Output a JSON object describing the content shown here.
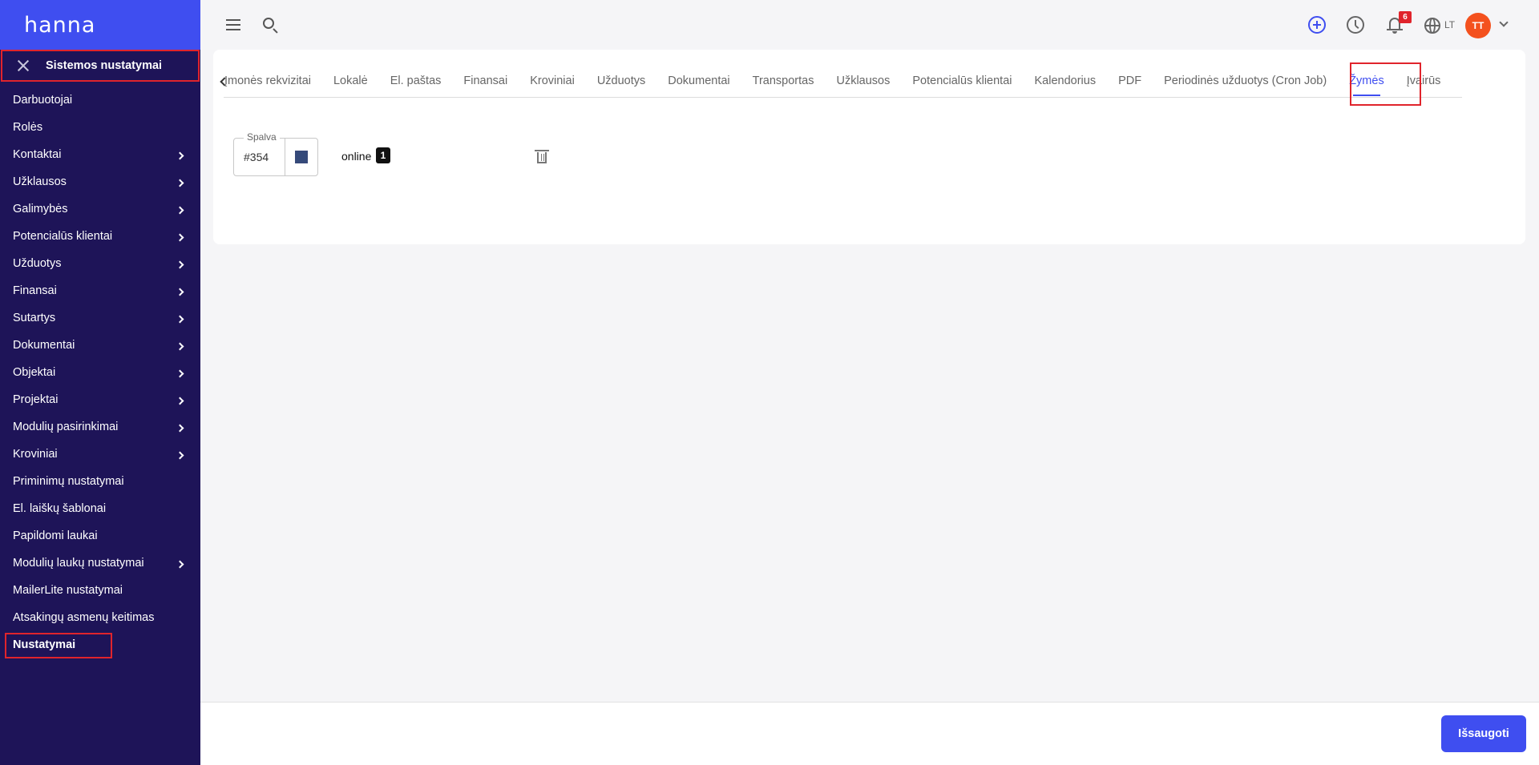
{
  "app": {
    "logo": "hanna"
  },
  "sidebar": {
    "header_title": "Sistemos nustatymai",
    "items": [
      {
        "label": "Darbuotojai",
        "chevron": false
      },
      {
        "label": "Rolės",
        "chevron": false
      },
      {
        "label": "Kontaktai",
        "chevron": true
      },
      {
        "label": "Užklausos",
        "chevron": true
      },
      {
        "label": "Galimybės",
        "chevron": true
      },
      {
        "label": "Potencialūs klientai",
        "chevron": true
      },
      {
        "label": "Užduotys",
        "chevron": true
      },
      {
        "label": "Finansai",
        "chevron": true
      },
      {
        "label": "Sutartys",
        "chevron": true
      },
      {
        "label": "Dokumentai",
        "chevron": true
      },
      {
        "label": "Objektai",
        "chevron": true
      },
      {
        "label": "Projektai",
        "chevron": true
      },
      {
        "label": "Modulių pasirinkimai",
        "chevron": true
      },
      {
        "label": "Kroviniai",
        "chevron": true
      },
      {
        "label": "Priminimų nustatymai",
        "chevron": false
      },
      {
        "label": "El. laiškų šablonai",
        "chevron": false
      },
      {
        "label": "Papildomi laukai",
        "chevron": false
      },
      {
        "label": "Modulių laukų nustatymai",
        "chevron": true
      },
      {
        "label": "MailerLite nustatymai",
        "chevron": false
      },
      {
        "label": "Atsakingų asmenų keitimas",
        "chevron": false
      },
      {
        "label": "Nustatymai",
        "chevron": false,
        "active": true
      }
    ]
  },
  "topbar": {
    "notification_count": "6",
    "language": "LT",
    "avatar_initials": "TT"
  },
  "tabs": {
    "items": [
      "Įmonės rekvizitai",
      "Lokalė",
      "El. paštas",
      "Finansai",
      "Kroviniai",
      "Užduotys",
      "Dokumentai",
      "Transportas",
      "Užklausos",
      "Potencialūs klientai",
      "Kalendorius",
      "PDF",
      "Periodinės užduotys (Cron Job)",
      "Žymės",
      "Įvairūs"
    ],
    "active": "Žymės"
  },
  "tag": {
    "color_legend": "Spalva",
    "color_value": "#354",
    "swatch_color": "#354a7a",
    "name": "online",
    "count": "1"
  },
  "footer": {
    "save_label": "Išsaugoti"
  },
  "colors": {
    "accent": "#3f4ef0",
    "sidebar_bg": "#1e1458",
    "highlight": "#e0242c",
    "avatar": "#f4511e"
  }
}
